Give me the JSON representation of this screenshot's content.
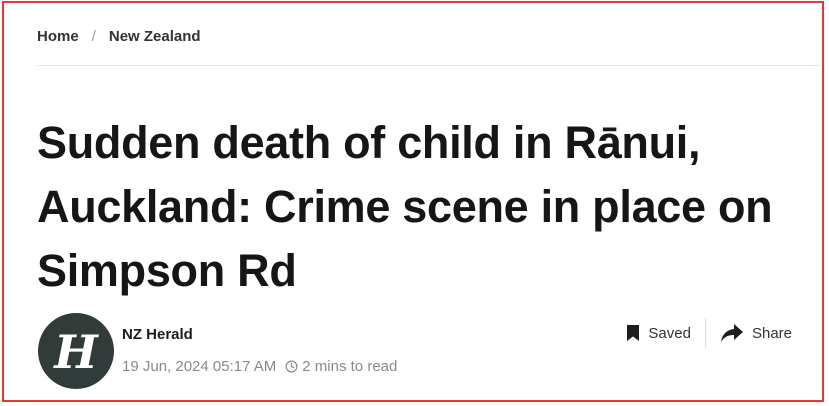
{
  "breadcrumb": {
    "home": "Home",
    "separator": "/",
    "section": "New Zealand"
  },
  "article": {
    "headline": "Sudden death of child in Rānui, Auckland: Crime scene in place on Simpson Rd",
    "author": "NZ Herald",
    "date": "19 Jun, 2024 05:17 AM",
    "read_time": "2 mins to read"
  },
  "actions": {
    "saved_label": "Saved",
    "share_label": "Share"
  },
  "icons": {
    "avatar": "nz-herald-logo-icon",
    "clock": "clock-icon",
    "bookmark": "bookmark-icon",
    "share": "share-arrow-icon"
  },
  "colors": {
    "frame_border": "#e53935",
    "avatar_bg": "#313b3a",
    "meta_text": "#8a8a8a"
  }
}
